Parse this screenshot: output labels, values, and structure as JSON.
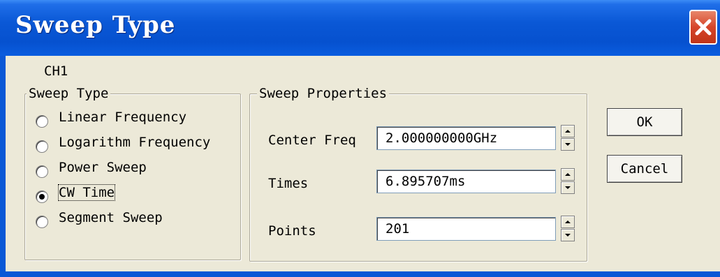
{
  "window": {
    "title": "Sweep Type"
  },
  "channel_label": "CH1",
  "sweep_type": {
    "legend": "Sweep Type",
    "options": [
      {
        "label": "Linear Frequency",
        "selected": false
      },
      {
        "label": "Logarithm Frequency",
        "selected": false
      },
      {
        "label": "Power Sweep",
        "selected": false
      },
      {
        "label": "CW Time",
        "selected": true
      },
      {
        "label": "Segment Sweep",
        "selected": false
      }
    ]
  },
  "sweep_properties": {
    "legend": "Sweep Properties",
    "center_freq": {
      "label": "Center Freq",
      "value": "2.000000000GHz"
    },
    "times": {
      "label": "Times",
      "value": "6.895707ms"
    },
    "points": {
      "label": "Points",
      "value": "201"
    }
  },
  "buttons": {
    "ok": "OK",
    "cancel": "Cancel"
  },
  "icons": {
    "close": "close-icon",
    "spin_up": "spin-up-arrow-icon",
    "spin_down": "spin-down-arrow-icon"
  },
  "colors": {
    "titlebar": "#0a58d6",
    "close_button": "#d6452a",
    "dialog_bg": "#ece9d8"
  }
}
